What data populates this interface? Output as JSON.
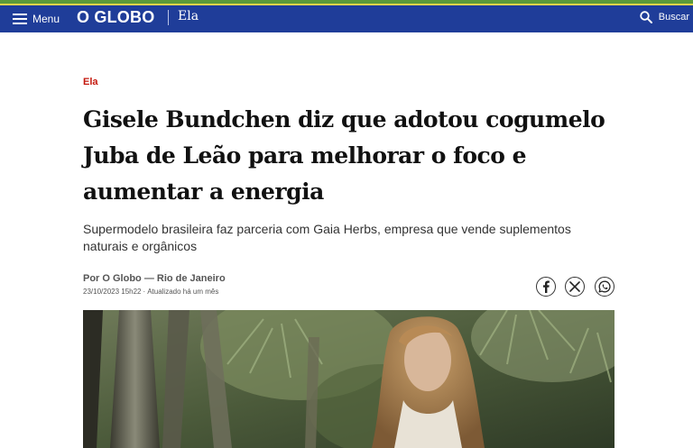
{
  "header": {
    "menu_label": "Menu",
    "logo": "O GLOBO",
    "section": "Ela",
    "search_label": "Buscar",
    "menu_icon": "hamburger-menu-icon",
    "search_icon": "search-icon",
    "brand_color": "#1f3d99"
  },
  "article": {
    "kicker": "Ela",
    "kicker_color": "#c4170c",
    "headline": "Gisele Bundchen diz que adotou cogumelo Juba de Leão para melhorar o foco e aumentar a energia",
    "subtitle": "Supermodelo brasileira faz parceria com Gaia Herbs, empresa que vende suplementos naturais e orgânicos",
    "byline": "Por O Globo — Rio de Janeiro",
    "published": "23/10/2023 15h22",
    "updated": "Atualizado há um mês",
    "share": {
      "facebook_icon": "facebook-icon",
      "x_icon": "x-twitter-icon",
      "whatsapp_icon": "whatsapp-icon"
    },
    "image": "photo of woman among palm foliage"
  }
}
